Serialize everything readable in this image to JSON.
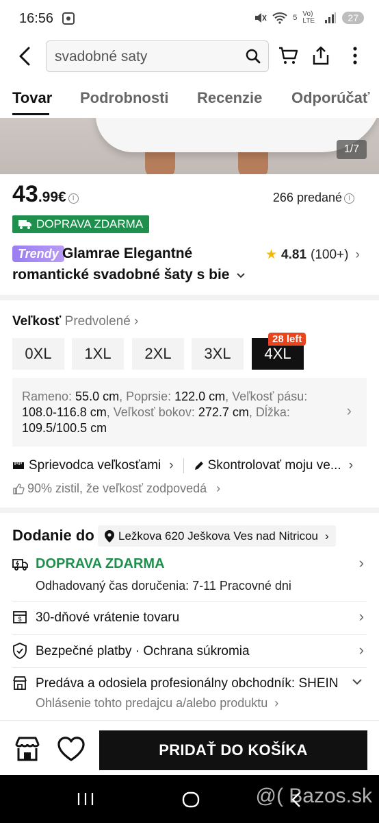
{
  "status_bar": {
    "time": "16:56",
    "battery": "27",
    "net": "5",
    "lte": "Vo) LTE"
  },
  "search": {
    "query": "svadobné saty"
  },
  "tabs": [
    {
      "label": "Tovar"
    },
    {
      "label": "Podrobnosti"
    },
    {
      "label": "Recenzie"
    },
    {
      "label": "Odporúčať"
    }
  ],
  "gallery": {
    "counter": "1/7"
  },
  "product": {
    "price_whole": "43",
    "price_fraction": ".99€",
    "sold": "266 predané",
    "shipping_badge": "DOPRAVA ZDARMA",
    "brand_tag": "Trendy",
    "title_line1": "Glamrae Elegantné",
    "title_line2": "romantické svadobné šaty s bie",
    "rating": "4.81",
    "rating_count": "(100+)"
  },
  "size": {
    "label": "Veľkosť",
    "sublabel": "Predvolené",
    "options": [
      "0XL",
      "1XL",
      "2XL",
      "3XL",
      "4XL"
    ],
    "selected": "4XL",
    "stock_badge": "28 left",
    "measurements": {
      "shoulder_label": "Rameno: ",
      "shoulder": "55.0 cm",
      "bust_label": ", Poprsie: ",
      "bust": "122.0 cm",
      "waist_label": ", Veľkosť pásu:",
      "waist": "108.0-116.8 cm",
      "hip_label": ", Veľkosť bokov: ",
      "hip": "272.7 cm",
      "length_label": ", Dĺžka:",
      "length": "109.5/100.5 cm"
    },
    "guide": "Sprievodca veľkosťami",
    "check": "Skontrolovať moju ve...",
    "fit": "90% zistil, že veľkosť zodpovedá"
  },
  "delivery": {
    "title": "Dodanie do",
    "address": "Ležkova 620 Ješkova Ves nad Nitricou",
    "free": "DOPRAVA ZDARMA",
    "eta": "Odhadovaný čas doručenia: 7-11 Pracovné dni",
    "returns": "30-dňové vrátenie tovaru",
    "payments": "Bezpečné platby · Ochrana súkromia",
    "seller": "Predáva a odosiela profesionálny obchodník: SHEIN",
    "report": "Ohlásenie tohto predajcu a/alebo produktu"
  },
  "actions": {
    "add_to_cart": "PRIDAŤ DO KOŠÍKA"
  },
  "watermark": "@( Bazos.sk"
}
